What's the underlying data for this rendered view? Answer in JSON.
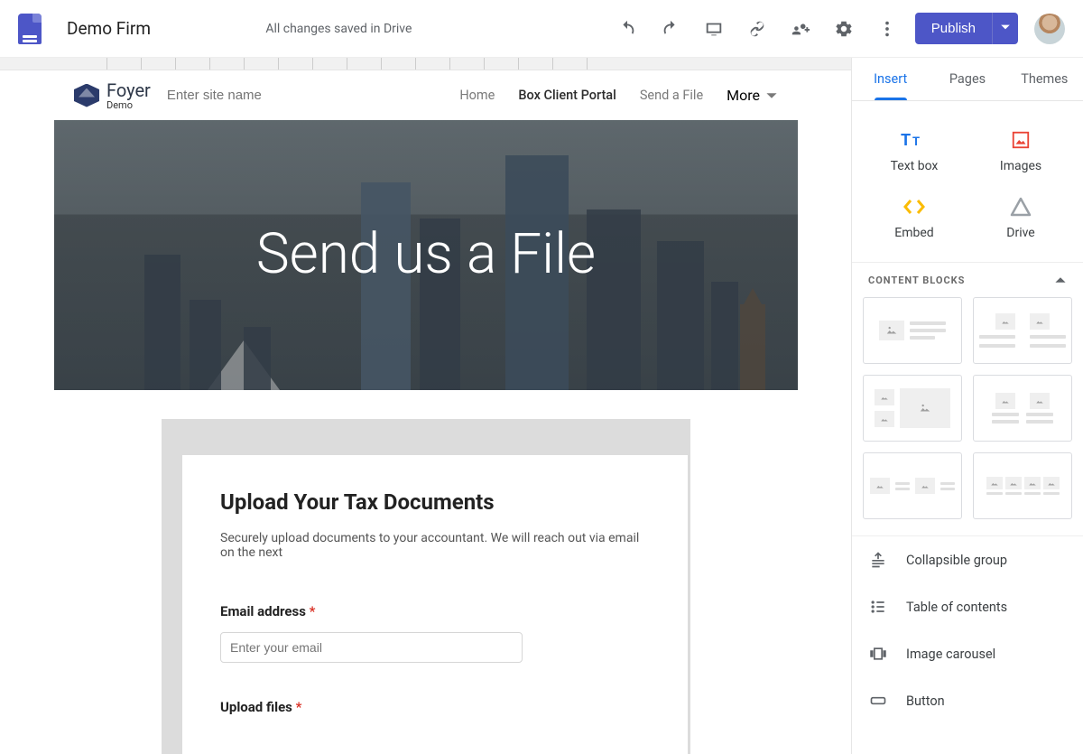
{
  "header": {
    "doc_title": "Demo Firm",
    "save_status": "All changes saved in Drive",
    "publish_label": "Publish"
  },
  "site": {
    "logo_text": "Foyer",
    "logo_sub": "Demo",
    "name_placeholder": "Enter site name",
    "nav": {
      "home": "Home",
      "portal": "Box Client Portal",
      "send": "Send a File",
      "more": "More"
    },
    "hero_title": "Send us a File"
  },
  "form": {
    "title": "Upload Your Tax Documents",
    "desc": "Securely upload documents to your accountant. We will reach out via email on the next",
    "email_label": "Email address",
    "email_placeholder": "Enter your email",
    "upload_label": "Upload files"
  },
  "panel": {
    "tabs": {
      "insert": "Insert",
      "pages": "Pages",
      "themes": "Themes"
    },
    "inserts": {
      "textbox": "Text box",
      "images": "Images",
      "embed": "Embed",
      "drive": "Drive"
    },
    "section": "CONTENT BLOCKS",
    "components": {
      "collapsible": "Collapsible group",
      "toc": "Table of contents",
      "carousel": "Image carousel",
      "button": "Button"
    }
  }
}
